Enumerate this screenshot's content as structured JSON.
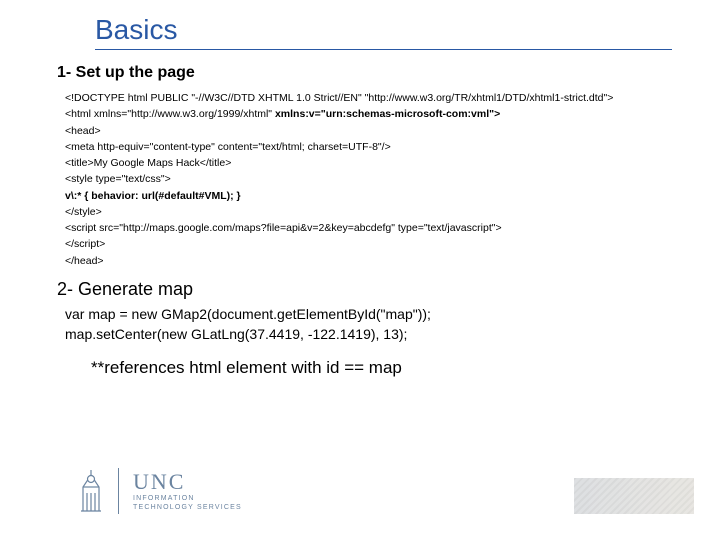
{
  "title": "Basics",
  "section1": {
    "heading": "1- Set up the page",
    "lines": [
      {
        "text": "<!DOCTYPE html PUBLIC \"-//W3C//DTD XHTML 1.0 Strict//EN\" \"http://www.w3.org/TR/xhtml1/DTD/xhtml1-strict.dtd\">"
      },
      {
        "prefix": "<html xmlns=\"http://www.w3.org/1999/xhtml\" ",
        "bold": "xmlns:v=\"urn:schemas-microsoft-com:vml\">"
      },
      {
        "text": "<head>"
      },
      {
        "text": "<meta http-equiv=\"content-type\" content=\"text/html; charset=UTF-8\"/>"
      },
      {
        "text": "<title>My Google Maps Hack</title>"
      },
      {
        "text": "<style type=\"text/css\">"
      },
      {
        "bold": "v\\:* { behavior: url(#default#VML); }"
      },
      {
        "text": "</style>"
      },
      {
        "text": "<script src=\"http://maps.google.com/maps?file=api&v=2&key=abcdefg\" type=\"text/javascript\">"
      },
      {
        "text": "</script>"
      },
      {
        "text": "</head>"
      }
    ]
  },
  "section2": {
    "heading": "2- Generate map",
    "code_line1": "var map = new GMap2(document.getElementById(\"map\"));",
    "code_line2": "map.setCenter(new GLatLng(37.4419, -122.1419), 13);",
    "note": "**references html element with id == map"
  },
  "footer": {
    "org_big": "UNC",
    "org_line1": "INFORMATION",
    "org_line2": "TECHNOLOGY SERVICES"
  }
}
